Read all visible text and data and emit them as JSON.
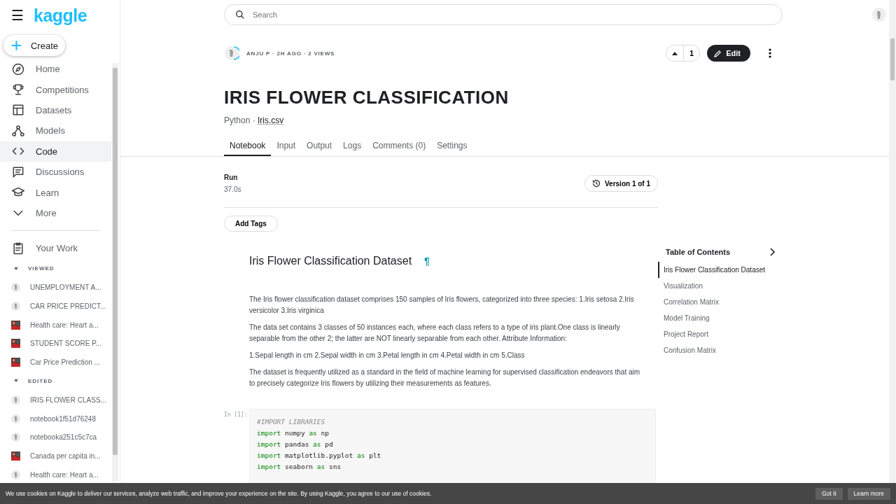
{
  "header": {
    "logo": "kaggle",
    "menu_glyph": "☰",
    "search": {
      "placeholder": "Search"
    }
  },
  "sidebar": {
    "create": "Create",
    "nav": [
      {
        "label": "Home",
        "selected": false
      },
      {
        "label": "Competitions",
        "selected": false
      },
      {
        "label": "Datasets",
        "selected": false
      },
      {
        "label": "Models",
        "selected": false
      },
      {
        "label": "Code",
        "selected": true
      },
      {
        "label": "Discussions",
        "selected": false
      },
      {
        "label": "Learn",
        "selected": false
      },
      {
        "label": "More",
        "selected": false
      }
    ],
    "your_work": "Your Work",
    "sections": [
      {
        "title": "VIEWED",
        "expanded": true,
        "items": [
          {
            "label": "UNEMPLOYMENT A...",
            "kind": "avatar"
          },
          {
            "label": "CAR PRICE PREDICT...",
            "kind": "avatar"
          },
          {
            "label": "Health care: Heart a...",
            "kind": "picture"
          },
          {
            "label": "STUDENT SCORE P...",
            "kind": "picture"
          },
          {
            "label": "Car Price Prediction ...",
            "kind": "picture"
          }
        ]
      },
      {
        "title": "EDITED",
        "expanded": true,
        "items": [
          {
            "label": "IRIS FLOWER CLASS...",
            "kind": "avatar"
          },
          {
            "label": "notebook1f51d76248",
            "kind": "avatar"
          },
          {
            "label": "notebooka251c5c7ca",
            "kind": "avatar"
          },
          {
            "label": "Canada per capita in...",
            "kind": "picture"
          },
          {
            "label": "Health care: Heart a...",
            "kind": "avatar"
          }
        ]
      }
    ]
  },
  "notebook": {
    "meta": "ANJU P · 2H AGO · 2 VIEWS",
    "upvotes": "1",
    "edit": "Edit",
    "title": "IRIS FLOWER CLASSIFICATION",
    "language": "Python · ",
    "source": "Iris.csv",
    "tabs": [
      {
        "label": "Notebook",
        "selected": true
      },
      {
        "label": "Input",
        "selected": false
      },
      {
        "label": "Output",
        "selected": false
      },
      {
        "label": "Logs",
        "selected": false
      },
      {
        "label": "Comments (0)",
        "selected": false
      },
      {
        "label": "Settings",
        "selected": false
      }
    ],
    "run": {
      "label": "Run",
      "time": "37.0s"
    },
    "version": "Version 1 of 1",
    "add_tags": "Add Tags",
    "heading": "Iris Flower Classification Dataset",
    "anchor": "¶",
    "paragraphs": [
      "The Iris flower classification dataset comprises 150 samples of Iris flowers, categorized into three species: 1.Iris setosa 2.Iris versicolor 3.Iris virginica",
      "The data set contains 3 classes of 50 instances each, where each class refers to a type of iris plant.One class is linearly separable from the other 2; the latter are NOT linearly separable from each other. Attribute Information:",
      "1.Sepal length in cm 2.Sepal width in cm 3.Petal length in cm 4.Petal width in cm 5.Class",
      "The dataset is frequently utilized as a standard in the field of machine learning for supervised classification endeavors that aim to precisely categorize Iris flowers by utilizing their measurements as features."
    ],
    "cell": {
      "prompt": "In [1]:",
      "lines": [
        [
          {
            "text": "#IMPORT LIBRARIES",
            "kind": "comment"
          }
        ],
        [
          {
            "text": "import",
            "kind": "keyword"
          },
          {
            "text": " numpy ",
            "kind": "plain"
          },
          {
            "text": "as",
            "kind": "keyword"
          },
          {
            "text": " np",
            "kind": "plain"
          }
        ],
        [
          {
            "text": "import",
            "kind": "keyword"
          },
          {
            "text": " pandas ",
            "kind": "plain"
          },
          {
            "text": "as",
            "kind": "keyword"
          },
          {
            "text": " pd",
            "kind": "plain"
          }
        ],
        [
          {
            "text": "import",
            "kind": "keyword"
          },
          {
            "text": " matplotlib.pyplot ",
            "kind": "plain"
          },
          {
            "text": "as",
            "kind": "keyword"
          },
          {
            "text": " plt",
            "kind": "plain"
          }
        ],
        [
          {
            "text": "import",
            "kind": "keyword"
          },
          {
            "text": " seaborn ",
            "kind": "plain"
          },
          {
            "text": "as",
            "kind": "keyword"
          },
          {
            "text": " sns",
            "kind": "plain"
          }
        ]
      ]
    },
    "toc": {
      "title": "Table of Contents",
      "items": [
        {
          "label": "Iris Flower Classification Dataset",
          "selected": true
        },
        {
          "label": "Visualization",
          "selected": false
        },
        {
          "label": "Correlation Matrix",
          "selected": false
        },
        {
          "label": "Model Training",
          "selected": false
        },
        {
          "label": "Project Report",
          "selected": false
        },
        {
          "label": "Confusion Matrix",
          "selected": false
        }
      ]
    }
  },
  "cookie_bar": {
    "text": "We use cookies on Kaggle to deliver our services, analyze web traffic, and improve your experience on the site. By using Kaggle, you agree to our use of cookies.",
    "buttons": [
      "Got it",
      "Learn more"
    ]
  }
}
